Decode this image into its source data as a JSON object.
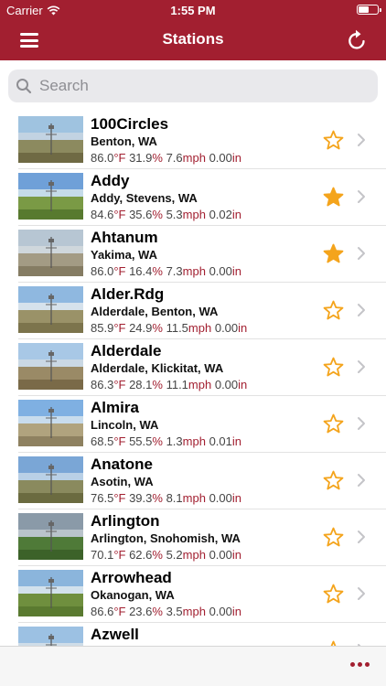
{
  "status_bar": {
    "carrier": "Carrier",
    "time": "1:55 PM",
    "battery_level": 0.6
  },
  "nav": {
    "title": "Stations",
    "left_icon": "hamburger-menu-icon",
    "right_icon": "refresh-icon"
  },
  "search": {
    "placeholder": "Search",
    "value": ""
  },
  "colors": {
    "brand": "#a21f30",
    "star": "#f4a41c"
  },
  "units": {
    "temp": "°F",
    "humidity": "%",
    "wind": "mph",
    "rain": "in"
  },
  "stations": [
    {
      "name": "100Circles",
      "location": "Benton, WA",
      "temp": "86.0",
      "humidity": "31.9",
      "wind": "7.6",
      "rain": "0.00",
      "favorite": false
    },
    {
      "name": "Addy",
      "location": "Addy, Stevens, WA",
      "temp": "84.6",
      "humidity": "35.6",
      "wind": "5.3",
      "rain": "0.02",
      "favorite": true
    },
    {
      "name": "Ahtanum",
      "location": "Yakima, WA",
      "temp": "86.0",
      "humidity": "16.4",
      "wind": "7.3",
      "rain": "0.00",
      "favorite": true
    },
    {
      "name": "Alder.Rdg",
      "location": "Alderdale, Benton, WA",
      "temp": "85.9",
      "humidity": "24.9",
      "wind": "11.5",
      "rain": "0.00",
      "favorite": false
    },
    {
      "name": "Alderdale",
      "location": "Alderdale, Klickitat, WA",
      "temp": "86.3",
      "humidity": "28.1",
      "wind": "11.1",
      "rain": "0.00",
      "favorite": false
    },
    {
      "name": "Almira",
      "location": "Lincoln, WA",
      "temp": "68.5",
      "humidity": "55.5",
      "wind": "1.3",
      "rain": "0.01",
      "favorite": false
    },
    {
      "name": "Anatone",
      "location": "Asotin, WA",
      "temp": "76.5",
      "humidity": "39.3",
      "wind": "8.1",
      "rain": "0.00",
      "favorite": false
    },
    {
      "name": "Arlington",
      "location": "Arlington, Snohomish, WA",
      "temp": "70.1",
      "humidity": "62.6",
      "wind": "5.2",
      "rain": "0.00",
      "favorite": false
    },
    {
      "name": "Arrowhead",
      "location": "Okanogan, WA",
      "temp": "86.6",
      "humidity": "23.6",
      "wind": "3.5",
      "rain": "0.00",
      "favorite": false
    },
    {
      "name": "Azwell",
      "location": "",
      "temp": "",
      "humidity": "",
      "wind": "",
      "rain": "",
      "favorite": false
    }
  ],
  "bottom_bar": {
    "more_icon": "more-dots-icon"
  }
}
